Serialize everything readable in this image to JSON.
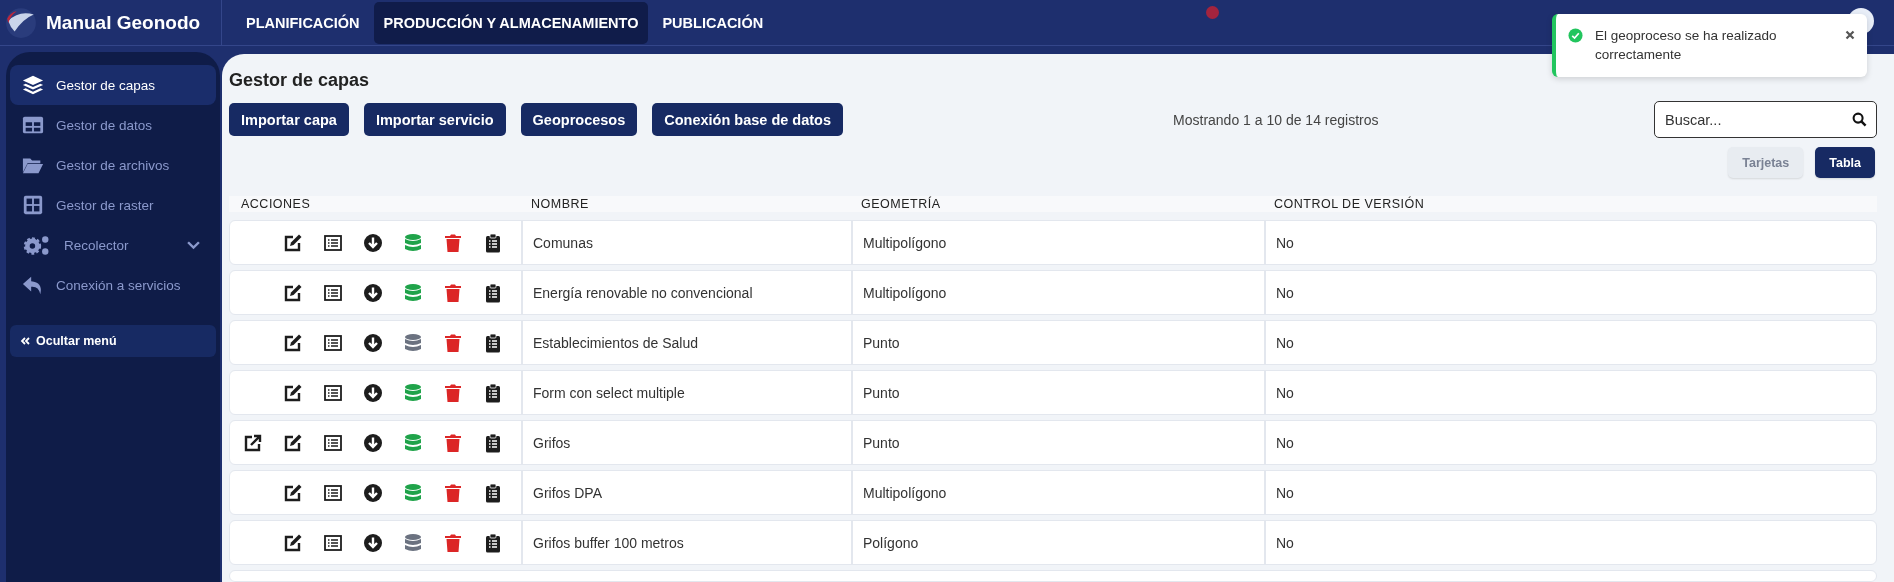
{
  "app": {
    "title": "Manual Geonodo"
  },
  "topnav": [
    {
      "label": "PLANIFICACIÓN",
      "selected": false
    },
    {
      "label": "PRODUCCIÓN Y ALMACENAMIENTO",
      "selected": true
    },
    {
      "label": "PUBLICACIÓN",
      "selected": false
    }
  ],
  "sidebar": {
    "items": [
      {
        "label": "Gestor de capas",
        "kind": "layers",
        "selected": true
      },
      {
        "label": "Gestor de datos",
        "kind": "table",
        "selected": false
      },
      {
        "label": "Gestor de archivos",
        "kind": "folder",
        "selected": false
      },
      {
        "label": "Gestor de raster",
        "kind": "grid",
        "selected": false
      },
      {
        "label": "Recolector",
        "kind": "gears",
        "selected": false,
        "expandable": true
      },
      {
        "label": "Conexión a servicios",
        "kind": "reply",
        "selected": false
      }
    ],
    "hide_button": "Ocultar menú"
  },
  "page": {
    "title": "Gestor de capas",
    "buttons": [
      "Importar capa",
      "Importar servicio",
      "Geoprocesos",
      "Conexión base de datos"
    ],
    "info": "Mostrando 1 a 10 de 14 registros",
    "search": {
      "placeholder": "Buscar..."
    },
    "views": [
      {
        "label": "Tarjetas",
        "selected": false
      },
      {
        "label": "Tabla",
        "selected": true
      }
    ]
  },
  "table": {
    "columns": [
      "ACCIONES",
      "NOMBRE",
      "GEOMETRÍA",
      "CONTROL DE VERSIÓN"
    ],
    "rows": [
      {
        "external_link": false,
        "db_active": true,
        "name": "Comunas",
        "geometry": "Multipolígono",
        "versioning": "No"
      },
      {
        "external_link": false,
        "db_active": true,
        "name": "Energía renovable no convencional",
        "geometry": "Multipolígono",
        "versioning": "No"
      },
      {
        "external_link": false,
        "db_active": false,
        "name": "Establecimientos de Salud",
        "geometry": "Punto",
        "versioning": "No"
      },
      {
        "external_link": false,
        "db_active": true,
        "name": "Form con select multiple",
        "geometry": "Punto",
        "versioning": "No"
      },
      {
        "external_link": true,
        "db_active": true,
        "name": "Grifos",
        "geometry": "Punto",
        "versioning": "No"
      },
      {
        "external_link": false,
        "db_active": true,
        "name": "Grifos DPA",
        "geometry": "Multipolígono",
        "versioning": "No"
      },
      {
        "external_link": false,
        "db_active": false,
        "name": "Grifos buffer 100 metros",
        "geometry": "Polígono",
        "versioning": "No"
      }
    ]
  },
  "toast": {
    "message": "El geoproceso se ha realizado correctamente",
    "kind": "success"
  }
}
